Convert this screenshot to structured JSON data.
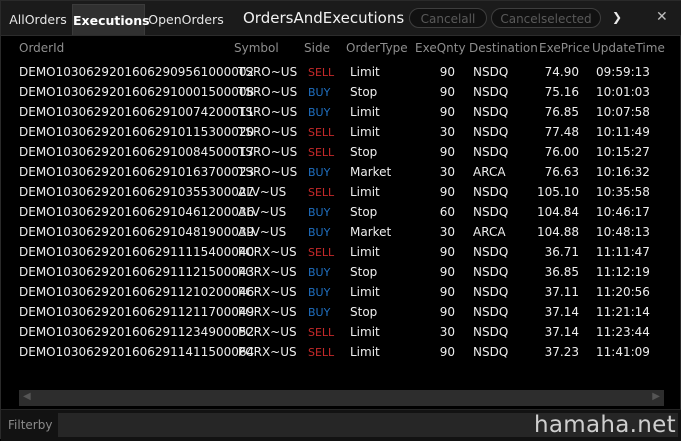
{
  "tabs": [
    "All Orders",
    "Executions",
    "Open Orders"
  ],
  "window_title": "Orders And Executions",
  "buttons": {
    "cancel_all": "Cancel all",
    "cancel_selected": "Cancel selected"
  },
  "icons": {
    "more": "chevron-right-icon",
    "close": "close-icon"
  },
  "colors": {
    "sell": "#c62a2a",
    "buy": "#1f6fc0"
  },
  "columns": [
    "Order Id",
    "Symbol",
    "Side",
    "Order Type",
    "ExeQnty",
    "Destination",
    "ExePrice",
    "Update Time"
  ],
  "rows": [
    {
      "order_id": "DEMO103062920160629095610000 02",
      "symbol": "TSRO~US",
      "side": "SELL",
      "order_type": "Limit",
      "qty": "90",
      "dest": "NSDQ",
      "price": "74.90",
      "time": "09:59:13"
    },
    {
      "order_id": "DEMO103062920160629100015000 08",
      "symbol": "TSRO~US",
      "side": "BUY",
      "order_type": "Stop",
      "qty": "90",
      "dest": "NSDQ",
      "price": "75.16",
      "time": "10:01:03"
    },
    {
      "order_id": "DEMO103062920160629100742000 11",
      "symbol": "TSRO~US",
      "side": "BUY",
      "order_type": "Limit",
      "qty": "90",
      "dest": "NSDQ",
      "price": "76.85",
      "time": "10:07:58"
    },
    {
      "order_id": "DEMO103062920160629101153000 20",
      "symbol": "TSRO~US",
      "side": "SELL",
      "order_type": "Limit",
      "qty": "30",
      "dest": "NSDQ",
      "price": "77.48",
      "time": "10:11:49"
    },
    {
      "order_id": "DEMO103062920160629100845000 17",
      "symbol": "TSRO~US",
      "side": "SELL",
      "order_type": "Stop",
      "qty": "90",
      "dest": "NSDQ",
      "price": "76.00",
      "time": "10:15:27"
    },
    {
      "order_id": "DEMO103062920160629101637000 23",
      "symbol": "TSRO~US",
      "side": "BUY",
      "order_type": "Market",
      "qty": "30",
      "dest": "ARCA",
      "price": "76.63",
      "time": "10:16:32"
    },
    {
      "order_id": "DEMO103062920160629103553000 27",
      "symbol": "ALV~US",
      "side": "SELL",
      "order_type": "Limit",
      "qty": "90",
      "dest": "NSDQ",
      "price": "105.10",
      "time": "10:35:58"
    },
    {
      "order_id": "DEMO103062920160629104612000 36",
      "symbol": "ALV~US",
      "side": "BUY",
      "order_type": "Stop",
      "qty": "60",
      "dest": "NSDQ",
      "price": "104.84",
      "time": "10:46:17"
    },
    {
      "order_id": "DEMO103062920160629104819000 39",
      "symbol": "ALV~US",
      "side": "BUY",
      "order_type": "Market",
      "qty": "30",
      "dest": "ARCA",
      "price": "104.88",
      "time": "10:48:13"
    },
    {
      "order_id": "DEMO103062920160629111154000 40",
      "symbol": "PCRX~US",
      "side": "SELL",
      "order_type": "Limit",
      "qty": "90",
      "dest": "NSDQ",
      "price": "36.71",
      "time": "11:11:47"
    },
    {
      "order_id": "DEMO103062920160629111215000 43",
      "symbol": "PCRX~US",
      "side": "BUY",
      "order_type": "Stop",
      "qty": "90",
      "dest": "NSDQ",
      "price": "36.85",
      "time": "11:12:19"
    },
    {
      "order_id": "DEMO103062920160629112102000 46",
      "symbol": "PCRX~US",
      "side": "BUY",
      "order_type": "Limit",
      "qty": "90",
      "dest": "NSDQ",
      "price": "37.11",
      "time": "11:20:56"
    },
    {
      "order_id": "DEMO103062920160629112117000 49",
      "symbol": "PCRX~US",
      "side": "BUY",
      "order_type": "Stop",
      "qty": "90",
      "dest": "NSDQ",
      "price": "37.14",
      "time": "11:21:14"
    },
    {
      "order_id": "DEMO103062920160629112349000 52",
      "symbol": "PCRX~US",
      "side": "SELL",
      "order_type": "Limit",
      "qty": "30",
      "dest": "NSDQ",
      "price": "37.14",
      "time": "11:23:44"
    },
    {
      "order_id": "DEMO103062920160629114115000 64",
      "symbol": "PCRX~US",
      "side": "SELL",
      "order_type": "Limit",
      "qty": "90",
      "dest": "NSDQ",
      "price": "37.23",
      "time": "11:41:09"
    }
  ],
  "filter": {
    "label": "Filter by",
    "value": "",
    "placeholder": ""
  },
  "watermark": "hamaha.net"
}
